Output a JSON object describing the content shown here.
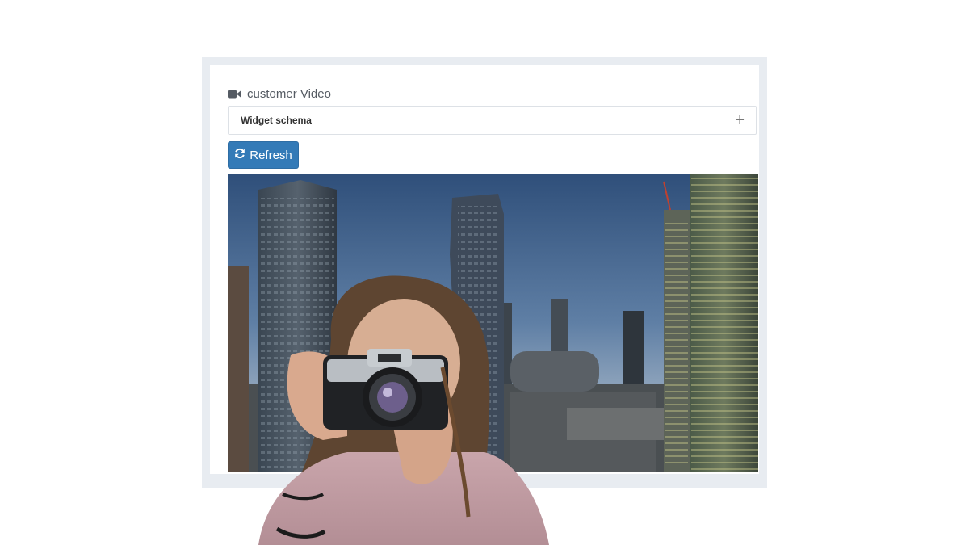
{
  "widget": {
    "title": "customer Video",
    "icon": "video-camera-icon"
  },
  "accordion": {
    "label": "Widget schema",
    "toggle": "+"
  },
  "toolbar": {
    "refresh_label": "Refresh",
    "refresh_icon": "refresh-icon"
  },
  "colors": {
    "accent": "#337ab7",
    "frame": "#e8ecf1"
  }
}
